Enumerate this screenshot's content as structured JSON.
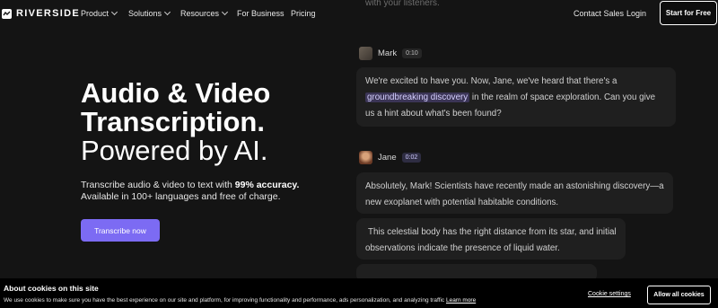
{
  "nav": {
    "logo": "RIVERSIDE",
    "items": [
      "Product",
      "Solutions",
      "Resources",
      "For Business",
      "Pricing"
    ],
    "contact_sales": "Contact Sales",
    "login": "Login",
    "start_free": "Start for Free"
  },
  "hero": {
    "title_line1": "Audio & Video",
    "title_line2": "Transcription.",
    "title_line3": "Powered by AI.",
    "sub_before": "Transcribe audio & video to text with ",
    "sub_bold": "99% accuracy.",
    "sub_line2": "Available in 100+ languages and free of charge.",
    "cta": "Transcribe now"
  },
  "transcript": {
    "faded_top": "with your listeners.",
    "entries": [
      {
        "speaker": "Mark",
        "time": "0:10",
        "avatar_icon": "mark-avatar",
        "text_before": "We're excited to have you. Now, Jane, we've heard that there's a ",
        "highlight": "groundbreaking discovery",
        "text_after": " in the realm of space exploration. Can you give us a hint about what's been found?"
      },
      {
        "speaker": "Jane",
        "time": "0:02",
        "avatar_icon": "jane-avatar",
        "bubble1": "Absolutely, Mark! Scientists have recently made an astonishing discovery—a new exoplanet with potential habitable conditions.",
        "bubble2": "This celestial body has the right distance from its star, and initial observations indicate the presence of liquid water."
      }
    ]
  },
  "cookie": {
    "title": "About cookies on this site",
    "text": "We use cookies to make sure you have the best experience on our site and platform, for improving functionality and performance, ads personalization, and analyzing traffic",
    "learn_more": "Learn more",
    "settings": "Cookie settings",
    "allow_all": "Allow all cookies"
  },
  "colors": {
    "background": "#141414",
    "accent": "#7c6bf3",
    "bubble": "#1f1f1f",
    "highlight": "#3b3556"
  }
}
